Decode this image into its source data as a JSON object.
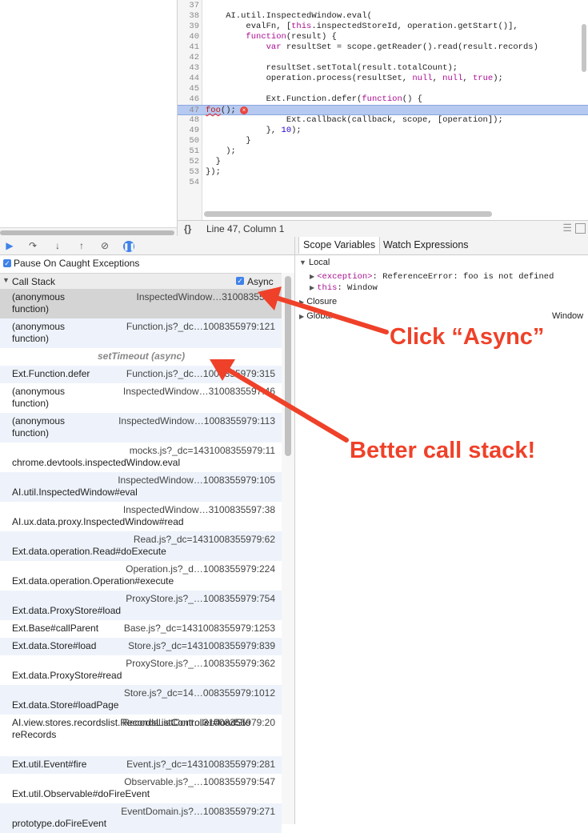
{
  "editor": {
    "lines": [
      {
        "n": "37",
        "code": ""
      },
      {
        "n": "38",
        "code": "    AI.util.InspectedWindow.eval("
      },
      {
        "n": "39",
        "code": "        evalFn, [this.inspectedStoreId, operation.getStart()],"
      },
      {
        "n": "40",
        "code": "        function(result) {"
      },
      {
        "n": "41",
        "code": "            var resultSet = scope.getReader().read(result.records)"
      },
      {
        "n": "42",
        "code": ""
      },
      {
        "n": "43",
        "code": "            resultSet.setTotal(result.totalCount);"
      },
      {
        "n": "44",
        "code": "            operation.process(resultSet, null, null, true);"
      },
      {
        "n": "45",
        "code": ""
      },
      {
        "n": "46",
        "code": "            Ext.Function.defer(function() {"
      },
      {
        "n": "47",
        "code": "foo();"
      },
      {
        "n": "48",
        "code": "                Ext.callback(callback, scope, [operation]);"
      },
      {
        "n": "49",
        "code": "            }, 10);"
      },
      {
        "n": "50",
        "code": "        }"
      },
      {
        "n": "51",
        "code": "    );"
      },
      {
        "n": "52",
        "code": "  }"
      },
      {
        "n": "53",
        "code": "});"
      },
      {
        "n": "54",
        "code": ""
      }
    ],
    "status": {
      "braces": "{}",
      "position": "Line 47, Column 1"
    }
  },
  "debugger": {
    "pause_label": "Pause On Caught Exceptions",
    "call_stack_title": "Call Stack",
    "async_label": "Async",
    "frames": [
      {
        "fn": "(anonymous\nfunction)",
        "loc": "InspectedWindow…3100835597"
      },
      {
        "fn": "(anonymous\nfunction)",
        "loc": "Function.js?_dc…1008355979:121"
      },
      {
        "fn": "setTimeout (async)",
        "loc": ""
      },
      {
        "fn": "Ext.Function.defer",
        "loc": "Function.js?_dc…1008355979:315"
      },
      {
        "fn": "(anonymous\nfunction)",
        "loc": "InspectedWindow…3100835597:46"
      },
      {
        "fn": "(anonymous\nfunction)",
        "loc": "InspectedWindow…1008355979:113"
      },
      {
        "fn": "chrome.devtools.inspectedWindow.eval",
        "loc": "mocks.js?_dc=1431008355979:11"
      },
      {
        "fn": "AI.util.InspectedWindow#eval",
        "loc": "InspectedWindow…1008355979:105"
      },
      {
        "fn": "AI.ux.data.proxy.InspectedWindow#read",
        "loc": "InspectedWindow…3100835597:38"
      },
      {
        "fn": "Ext.data.operation.Read#doExecute",
        "loc": "Read.js?_dc=1431008355979:62"
      },
      {
        "fn": "Ext.data.operation.Operation#execute",
        "loc": "Operation.js?_d…1008355979:224"
      },
      {
        "fn": "Ext.data.ProxyStore#load",
        "loc": "ProxyStore.js?_…1008355979:754"
      },
      {
        "fn": "Ext.Base#callParent",
        "loc": "Base.js?_dc=1431008355979:1253"
      },
      {
        "fn": "Ext.data.Store#load",
        "loc": "Store.js?_dc=1431008355979:839"
      },
      {
        "fn": "Ext.data.ProxyStore#read",
        "loc": "ProxyStore.js?_…1008355979:362"
      },
      {
        "fn": "Ext.data.Store#loadPage",
        "loc": "Store.js?_dc=14…008355979:1012"
      },
      {
        "fn": "AI.view.stores.recordslist.RecordsListController#loadSto\nreRecords",
        "loc": "RecordsListCont…31008355979:20"
      },
      {
        "fn": "Ext.util.Event#fire",
        "loc": "Event.js?_dc=1431008355979:281"
      },
      {
        "fn": "Ext.util.Observable#doFireEvent",
        "loc": "Observable.js?_…1008355979:547"
      },
      {
        "fn": "prototype.doFireEvent",
        "loc": "EventDomain.js?…1008355979:271"
      }
    ]
  },
  "scope": {
    "tabs": [
      "Scope Variables",
      "Watch Expressions"
    ],
    "local_label": "Local",
    "exception_key": "<exception>",
    "exception_value": "ReferenceError: foo is not defined",
    "this_key": "this",
    "this_value": "Window",
    "closure_label": "Closure",
    "global_label": "Global",
    "global_value": "Window"
  },
  "annotations": {
    "click_async": "Click “Async”",
    "better": "Better call stack!",
    "accent": "#ef4129"
  }
}
